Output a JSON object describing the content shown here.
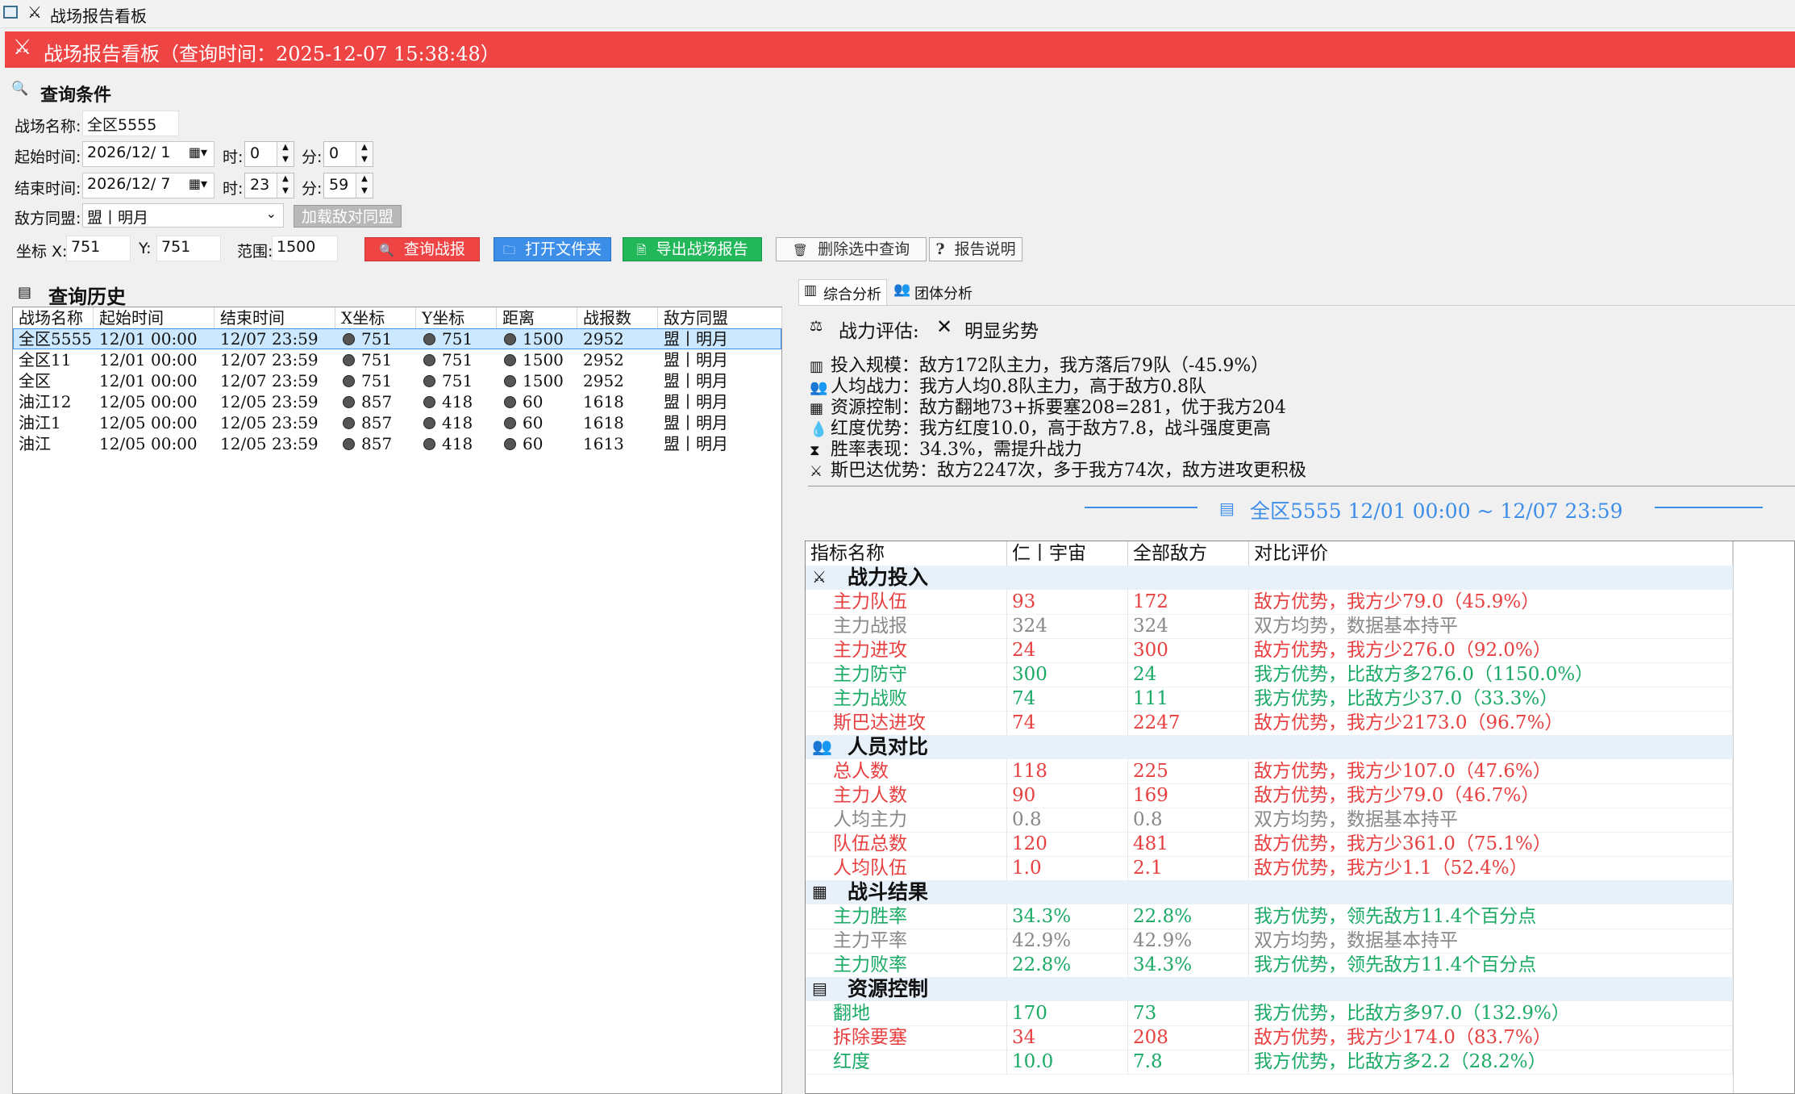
{
  "window": {
    "title": "战场报告看板"
  },
  "header": {
    "title": "战场报告看板（查询时间：2025-12-07 15:38:48）"
  },
  "query": {
    "section_title": "查询条件",
    "battlefield_label": "战场名称:",
    "battlefield_value": "全区5555",
    "start_label": "起始时间:",
    "start_date": "2026/12/ 1",
    "end_label": "结束时间:",
    "end_date": "2026/12/ 7",
    "hour_label": "时:",
    "minute_label": "分:",
    "start_hour": "0",
    "start_minute": "0",
    "end_hour": "23",
    "end_minute": "59",
    "enemy_label": "敌方同盟:",
    "enemy_value": "盟丨明月",
    "load_enemy_button": "加载敌对同盟",
    "coord_x_label": "坐标 X:",
    "coord_x_value": "751",
    "coord_y_label": "Y:",
    "coord_y_value": "751",
    "range_label": "范围:",
    "range_value": "1500",
    "buttons": {
      "query": "查询战报",
      "open_folder": "打开文件夹",
      "export": "导出战场报告",
      "delete": "删除选中查询",
      "help": "报告说明"
    }
  },
  "history": {
    "title": "查询历史",
    "columns": [
      "战场名称",
      "起始时间",
      "结束时间",
      "X坐标",
      "Y坐标",
      "距离",
      "战报数",
      "敌方同盟"
    ],
    "rows": [
      [
        "全区5555",
        "12/01 00:00",
        "12/07 23:59",
        "751",
        "751",
        "1500",
        "2952",
        "盟丨明月"
      ],
      [
        "全区11",
        "12/01 00:00",
        "12/07 23:59",
        "751",
        "751",
        "1500",
        "2952",
        "盟丨明月"
      ],
      [
        "全区",
        "12/01 00:00",
        "12/07 23:59",
        "751",
        "751",
        "1500",
        "2952",
        "盟丨明月"
      ],
      [
        "油江12",
        "12/05 00:00",
        "12/05 23:59",
        "857",
        "418",
        "60",
        "1618",
        "盟丨明月"
      ],
      [
        "油江1",
        "12/05 00:00",
        "12/05 23:59",
        "857",
        "418",
        "60",
        "1618",
        "盟丨明月"
      ],
      [
        "油江",
        "12/05 00:00",
        "12/05 23:59",
        "857",
        "418",
        "60",
        "1613",
        "盟丨明月"
      ]
    ]
  },
  "tabs": [
    "综合分析",
    "团体分析"
  ],
  "summary": {
    "assessment_label": "战力评估:",
    "assessment_value": "明显劣势",
    "lines": [
      "投入规模：敌方172队主力，我方落后79队（-45.9%）",
      "人均战力：我方人均0.8队主力，高于敌方0.8队",
      "资源控制：敌方翻地73+拆要塞208=281，优于我方204",
      "红度优势：我方红度10.0，高于敌方7.8，战斗强度更高",
      "胜率表现：34.3%，需提升战力",
      "斯巴达优势：敌方2247次，多于我方74次，敌方进攻更积极"
    ],
    "range_title": "全区5555 12/01 00:00 ~ 12/07 23:59"
  },
  "indicators": {
    "columns": [
      "指标名称",
      "仁丨宇宙",
      "全部敌方",
      "对比评价"
    ],
    "groups": [
      {
        "name": "战力投入",
        "rows": [
          {
            "name": "主力队伍",
            "ours": "93",
            "enemy": "172",
            "eval": "敌方优势，我方少79.0（45.9%）",
            "tone": "red"
          },
          {
            "name": "主力战报",
            "ours": "324",
            "enemy": "324",
            "eval": "双方均势，数据基本持平",
            "tone": "gray"
          },
          {
            "name": "主力进攻",
            "ours": "24",
            "enemy": "300",
            "eval": "敌方优势，我方少276.0（92.0%）",
            "tone": "red"
          },
          {
            "name": "主力防守",
            "ours": "300",
            "enemy": "24",
            "eval": "我方优势，比敌方多276.0（1150.0%）",
            "tone": "green"
          },
          {
            "name": "主力战败",
            "ours": "74",
            "enemy": "111",
            "eval": "我方优势，比敌方少37.0（33.3%）",
            "tone": "green"
          },
          {
            "name": "斯巴达进攻",
            "ours": "74",
            "enemy": "2247",
            "eval": "敌方优势，我方少2173.0（96.7%）",
            "tone": "red"
          }
        ]
      },
      {
        "name": "人员对比",
        "rows": [
          {
            "name": "总人数",
            "ours": "118",
            "enemy": "225",
            "eval": "敌方优势，我方少107.0（47.6%）",
            "tone": "red"
          },
          {
            "name": "主力人数",
            "ours": "90",
            "enemy": "169",
            "eval": "敌方优势，我方少79.0（46.7%）",
            "tone": "red"
          },
          {
            "name": "人均主力",
            "ours": "0.8",
            "enemy": "0.8",
            "eval": "双方均势，数据基本持平",
            "tone": "gray"
          },
          {
            "name": "队伍总数",
            "ours": "120",
            "enemy": "481",
            "eval": "敌方优势，我方少361.0（75.1%）",
            "tone": "red"
          },
          {
            "name": "人均队伍",
            "ours": "1.0",
            "enemy": "2.1",
            "eval": "敌方优势，我方少1.1（52.4%）",
            "tone": "red"
          }
        ]
      },
      {
        "name": "战斗结果",
        "rows": [
          {
            "name": "主力胜率",
            "ours": "34.3%",
            "enemy": "22.8%",
            "eval": "我方优势，领先敌方11.4个百分点",
            "tone": "green"
          },
          {
            "name": "主力平率",
            "ours": "42.9%",
            "enemy": "42.9%",
            "eval": "双方均势，数据基本持平",
            "tone": "gray"
          },
          {
            "name": "主力败率",
            "ours": "22.8%",
            "enemy": "34.3%",
            "eval": "我方优势，领先敌方11.4个百分点",
            "tone": "green"
          }
        ]
      },
      {
        "name": "资源控制",
        "rows": [
          {
            "name": "翻地",
            "ours": "170",
            "enemy": "73",
            "eval": "我方优势，比敌方多97.0（132.9%）",
            "tone": "green"
          },
          {
            "name": "拆除要塞",
            "ours": "34",
            "enemy": "208",
            "eval": "敌方优势，我方少174.0（83.7%）",
            "tone": "red"
          },
          {
            "name": "红度",
            "ours": "10.0",
            "enemy": "7.8",
            "eval": "我方优势，比敌方多2.2（28.2%）",
            "tone": "green"
          }
        ]
      }
    ]
  },
  "colors": {
    "header_bg": "#ee4444",
    "btn_query": "#ee4444",
    "btn_open": "#3c8ee8",
    "btn_export": "#22b85a",
    "positive": "#1aaa66",
    "negative": "#e84040",
    "neutral": "#888888"
  }
}
